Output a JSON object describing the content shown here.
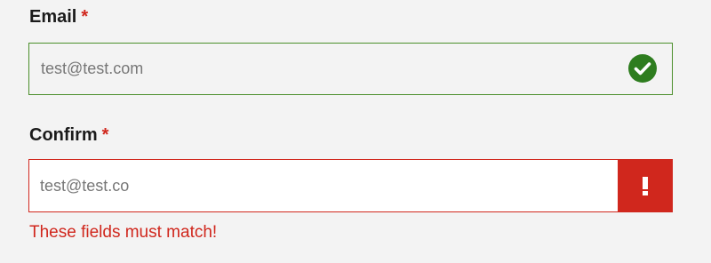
{
  "email": {
    "label": "Email",
    "required_marker": "*",
    "value": "test@test.com",
    "status": "valid",
    "status_icon": "check-circle-icon",
    "border_color": "#4b8f2b"
  },
  "confirm": {
    "label": "Confirm",
    "required_marker": "*",
    "value": "test@test.co",
    "status": "error",
    "status_icon": "exclamation-icon",
    "border_color": "#d0271d",
    "error_message": "These fields must match!"
  },
  "colors": {
    "error": "#d0271d",
    "success": "#2e7d1f",
    "background": "#f3f3f3"
  }
}
